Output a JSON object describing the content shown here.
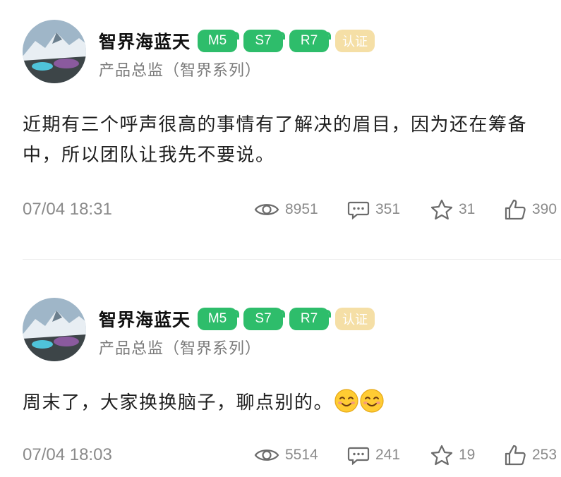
{
  "posts": [
    {
      "author": "智界海蓝天",
      "badges": [
        "M5",
        "S7",
        "R7",
        "认证"
      ],
      "role": "产品总监（智界系列）",
      "text": "近期有三个呼声很高的事情有了解决的眉目，因为还在筹备中，所以团队让我先不要说。",
      "time": "07/04 18:31",
      "views": "8951",
      "comments": "351",
      "favorites": "31",
      "likes": "390"
    },
    {
      "author": "智界海蓝天",
      "badges": [
        "M5",
        "S7",
        "R7",
        "认证"
      ],
      "role": "产品总监（智界系列）",
      "text": "周末了，大家换换脑子，聊点别的。",
      "emojis": [
        "smiling-face",
        "smiling-face"
      ],
      "time": "07/04 18:03",
      "views": "5514",
      "comments": "241",
      "favorites": "19",
      "likes": "253"
    }
  ],
  "colors": {
    "badge_green": "#2ebd6b",
    "badge_gold": "#f5dfa6",
    "meta_gray": "#8a8a8a",
    "role_gray": "#7a7a7a"
  },
  "icons": [
    "eye-icon",
    "comment-icon",
    "star-icon",
    "thumbs-up-icon",
    "smiling-face-emoji"
  ]
}
